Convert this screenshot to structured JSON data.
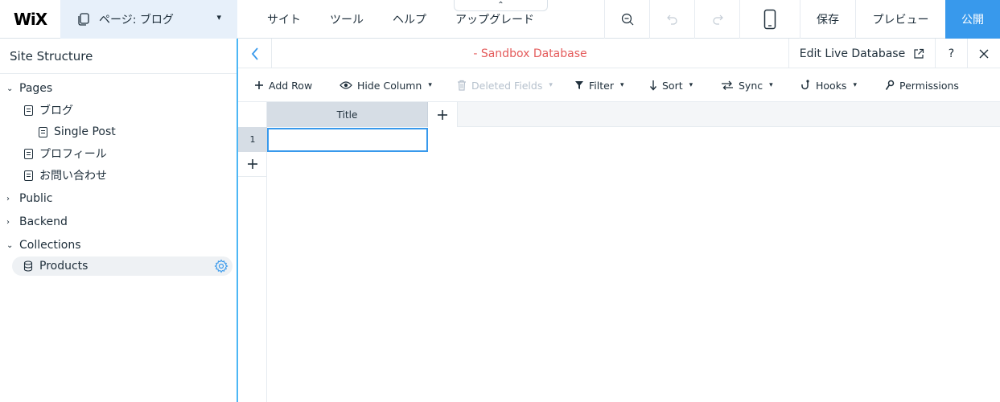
{
  "topbar": {
    "logo": "WiX",
    "page_selector": "ページ: ブログ",
    "menu": [
      "サイト",
      "ツール",
      "ヘルプ",
      "アップグレード"
    ],
    "upgrade_tab_glyph": "⌃",
    "save": "保存",
    "preview": "プレビュー",
    "publish": "公開",
    "accent_color": "#3899ec"
  },
  "sidebar": {
    "title": "Site Structure",
    "pages_label": "Pages",
    "pages": [
      "ブログ",
      "Single Post",
      "プロフィール",
      "お問い合わせ"
    ],
    "public_label": "Public",
    "backend_label": "Backend",
    "collections_label": "Collections",
    "collection_item": "Products"
  },
  "database": {
    "back_icon": "chevron-left-icon",
    "title": "- Sandbox Database",
    "title_color": "#e45b5b",
    "edit_live": "Edit Live Database",
    "help": "?",
    "toolbar": {
      "add_row": "Add Row",
      "hide_column": "Hide Column",
      "deleted_fields": "Deleted Fields",
      "filter": "Filter",
      "sort": "Sort",
      "sync": "Sync",
      "hooks": "Hooks",
      "permissions": "Permissions"
    },
    "columns": [
      "Title"
    ],
    "rows": [
      {
        "num": "1",
        "title": ""
      }
    ]
  }
}
